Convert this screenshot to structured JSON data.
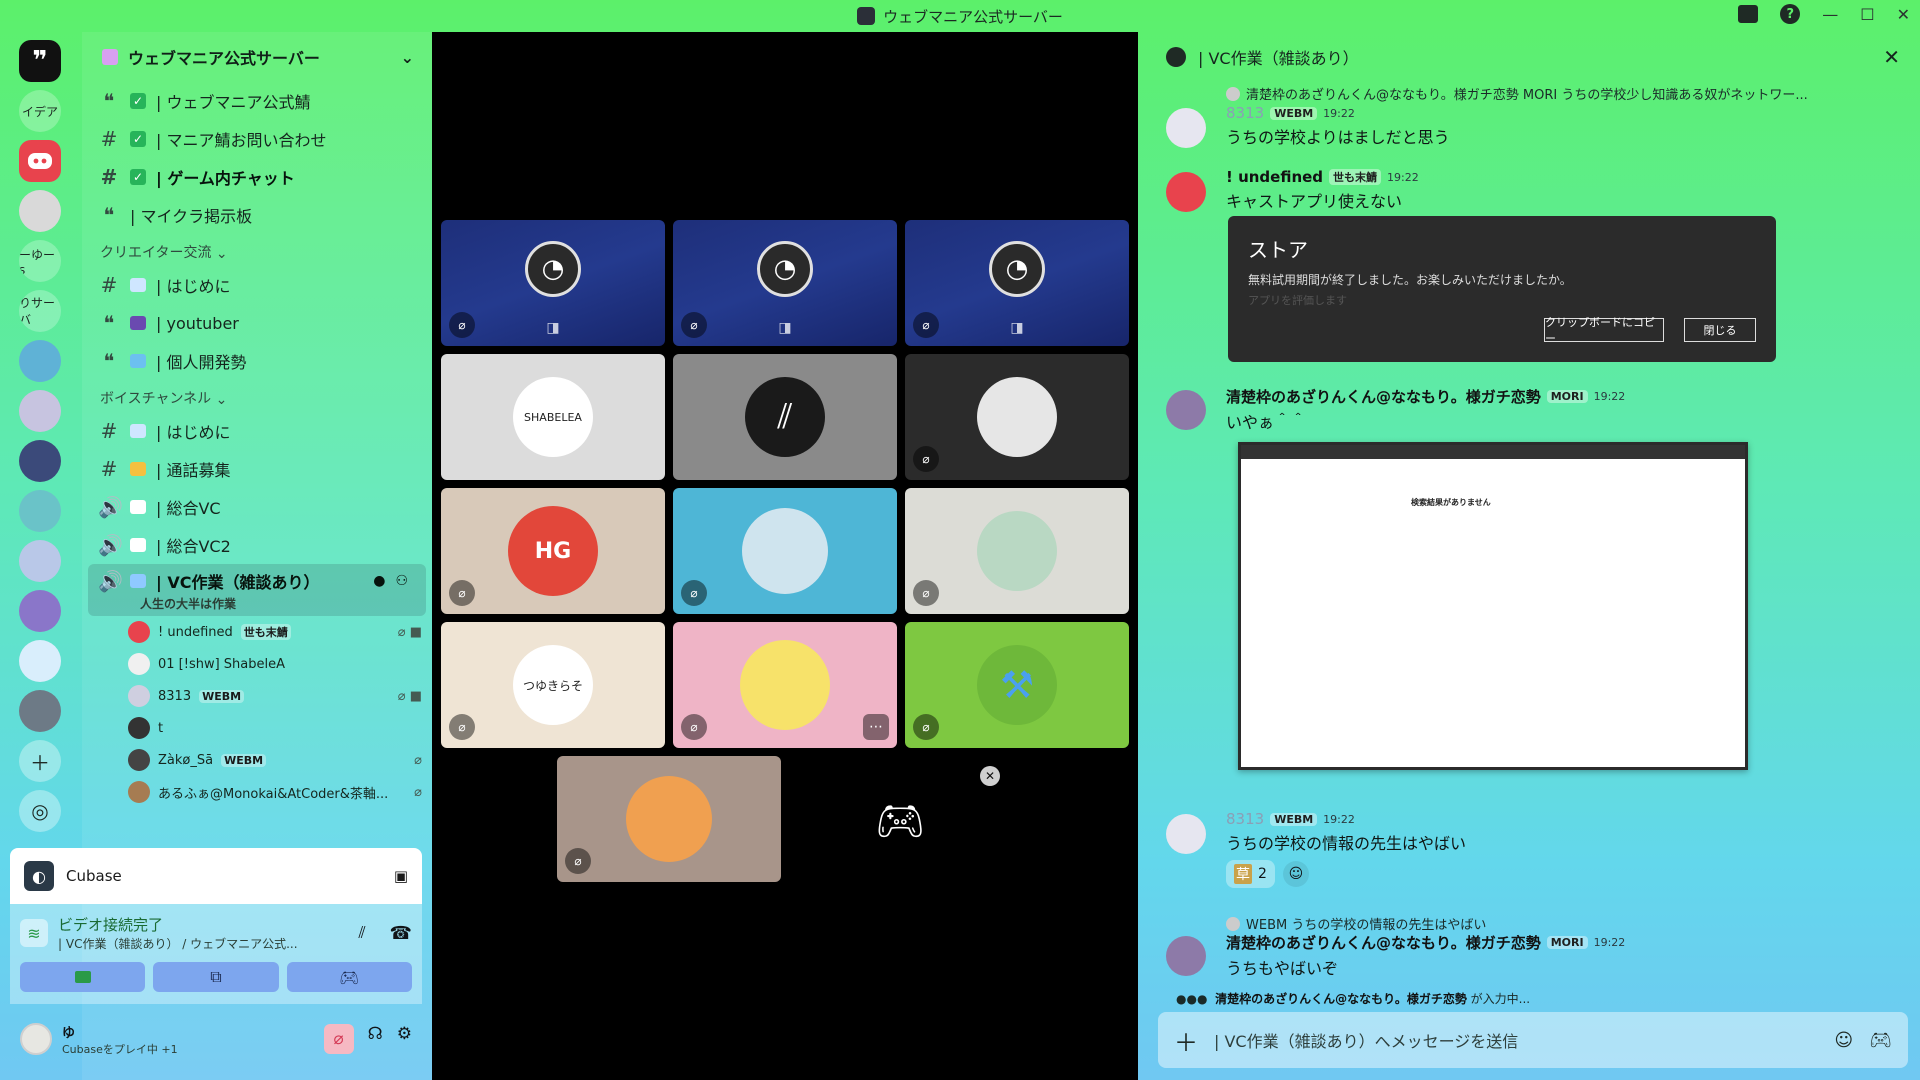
{
  "window": {
    "title": "ウェブマニア公式サーバー"
  },
  "rail": {
    "labels": [
      "イデア",
      "ーゆーs",
      "りサーバ"
    ]
  },
  "sidebar": {
    "server_name": "ウェブマニア公式サーバー",
    "channels_top": [
      {
        "label": "| ウェブマニア公式鯖"
      },
      {
        "label": "| マニア鯖お問い合わせ"
      },
      {
        "label": "| ゲーム内チャット"
      },
      {
        "label": "| マイクラ掲示板"
      }
    ],
    "cat1": "クリエイター交流",
    "channels_creator": [
      {
        "label": "| はじめに"
      },
      {
        "label": "| youtuber"
      },
      {
        "label": "| 個人開発勢"
      }
    ],
    "cat2": "ボイスチャンネル",
    "channels_voice": [
      {
        "label": "| はじめに"
      },
      {
        "label": "| 通話募集"
      },
      {
        "label": "| 総合VC"
      },
      {
        "label": "| 総合VC2"
      }
    ],
    "active_channel": {
      "label": "| VC作業（雑談あり）",
      "subtitle": "人生の大半は作業"
    },
    "voice_users": [
      {
        "name": "! undefined",
        "tag": "世も末鯖"
      },
      {
        "name": "01 [!shw] ShabeleA",
        "tag": ""
      },
      {
        "name": "8313",
        "tag": "WEBM"
      },
      {
        "name": "t",
        "tag": ""
      },
      {
        "name": "Zàkø_Sā",
        "tag": "WEBM"
      },
      {
        "name": "あるふぁ@Monokai&AtCoder&茶軸...",
        "tag": ""
      }
    ]
  },
  "activity": {
    "app": "Cubase"
  },
  "voice_panel": {
    "status": "ビデオ接続完了",
    "location": "| VC作業（雑談あり） / ウェブマニア公式..."
  },
  "user_panel": {
    "name": "ゆ",
    "status": "Cubaseをプレイ中 +1"
  },
  "tiles": {
    "shabelea_label": "SHABELEA",
    "yukisake_label": "つゆきらそ"
  },
  "thread": {
    "title": "| VC作業（雑談あり）",
    "reply1": "清楚枠のあざりんくん@ななもり。様ガチ恋勢 MORI うちの学校少し知識ある奴がネットワー...",
    "m1": {
      "name": "8313",
      "tag": "WEBM",
      "time": "19:22",
      "text": "うちの学校よりはましだと思う"
    },
    "m2": {
      "name": "! undefined",
      "tag": "世も末鯖",
      "time": "19:22",
      "text": "キャストアプリ使えない"
    },
    "store": {
      "heading": "ストア",
      "msg": "無料試用期間が終了しました。お楽しみいただけましたか。",
      "msg2": "アプリを評価します",
      "copy_btn": "クリップボードにコピー",
      "close_btn": "閉じる"
    },
    "m3": {
      "name": "清楚枠のあざりんくん@ななもり。様ガチ恋勢",
      "tag": "MORI",
      "time": "19:22",
      "text": "いやぁ＾＾"
    },
    "shot_title": "検索結果がありません",
    "m4": {
      "name": "8313",
      "tag": "WEBM",
      "time": "19:22",
      "text": "うちの学校の情報の先生はやばい"
    },
    "reaction": {
      "emoji": "草",
      "count": "2"
    },
    "reply2": "WEBM うちの学校の情報の先生はやばい",
    "m5": {
      "name": "清楚枠のあざりんくん@ななもり。様ガチ恋勢",
      "tag": "MORI",
      "time": "19:22",
      "text": "うちもやばいぞ"
    },
    "typing_user": "清楚枠のあざりんくん@ななもり。様ガチ恋勢",
    "typing_suffix": " が入力中...",
    "composer_placeholder": "| VC作業（雑談あり）へメッセージを送信"
  }
}
